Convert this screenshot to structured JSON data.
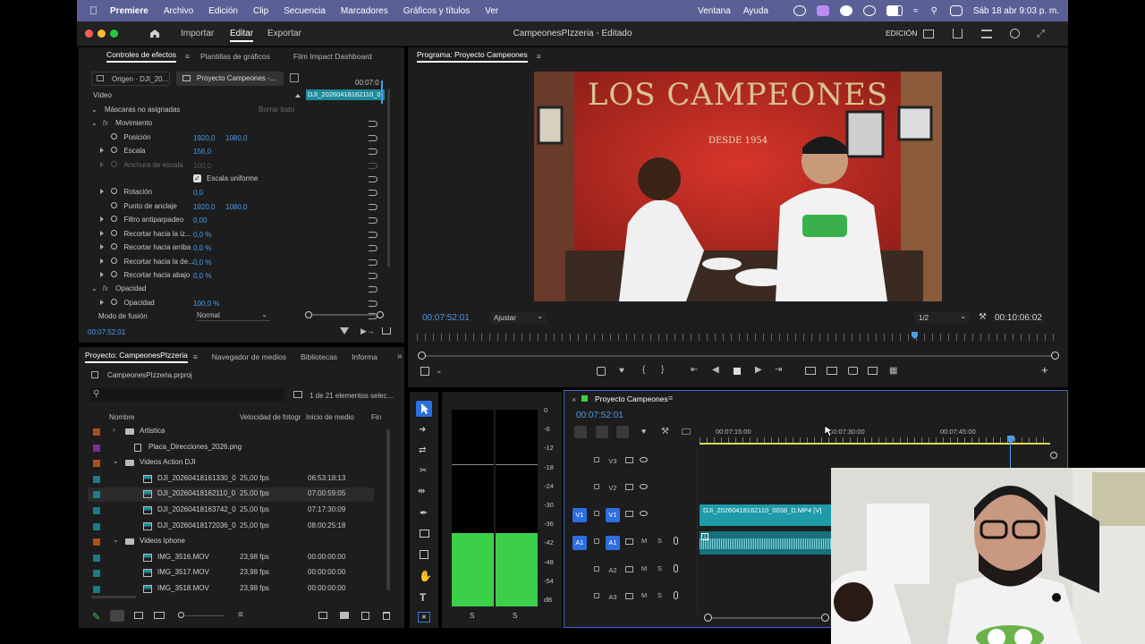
{
  "menubar": {
    "app": "Premiere",
    "items": [
      "Archivo",
      "Edición",
      "Clip",
      "Secuencia",
      "Marcadores",
      "Gráficos y títulos",
      "Ver"
    ],
    "right_items": [
      "Ventana",
      "Ayuda"
    ],
    "datetime": "Sáb 18 abr 9:03 p. m."
  },
  "titlebar": {
    "tabs": [
      "Importar",
      "Editar",
      "Exportar"
    ],
    "title": "CampeonesPIzzeria - Editado",
    "workspace": "EDICIÓN"
  },
  "effects_panel": {
    "tabs": [
      "Controles de efectos",
      "Plantillas de gráficos",
      "Film Impact Dashboard"
    ],
    "source_tab": "Origen · DJI_20...",
    "sequence_tab": "Proyecto Campeones -...",
    "mini_timecode": "00:07:0",
    "mini_clip": "DJI_20260418162110_0",
    "section": "Vídeo",
    "mask_label": "Máscaras no asignadas",
    "clear_all": "Borrar todo",
    "motion": "Movimiento",
    "position_label": "Posición",
    "position_x": "1920,0",
    "position_y": "1080,0",
    "scale_label": "Escala",
    "scale_value": "156,0",
    "scale_width_label": "Anchura de escala",
    "scale_width_value": "100,0",
    "uniform_scale_label": "Escala uniforme",
    "rotation_label": "Rotación",
    "rotation_value": "0,0",
    "anchor_label": "Punto de anclaje",
    "anchor_x": "1920,0",
    "anchor_y": "1080,0",
    "antiflicker_label": "Filtro antiparpadeo",
    "antiflicker_value": "0,00",
    "crop_left_label": "Recortar hacia la iz...",
    "crop_left_value": "0,0 %",
    "crop_top_label": "Recortar hacia arriba",
    "crop_top_value": "0,0 %",
    "crop_right_label": "Recortar hacia la de...",
    "crop_right_value": "0,0 %",
    "crop_bottom_label": "Recortar hacia abajo",
    "crop_bottom_value": "0,0 %",
    "opacity_section": "Opacidad",
    "opacity_label": "Opacidad",
    "opacity_value": "100,0 %",
    "blend_label": "Modo de fusión",
    "blend_value": "Normal",
    "timecode": "00:07:52:01"
  },
  "program_monitor": {
    "title": "Programa: Proyecto Campeones",
    "video_sign": "LOS CAMPEONES",
    "video_sign_sub": "DESDE 1954",
    "timecode": "00:07:52:01",
    "fit": "Ajustar",
    "resolution": "1/2",
    "duration": "00:10:06:02"
  },
  "project_panel": {
    "tabs": [
      "Proyecto: CampeonesPIzzeria",
      "Navegador de medios",
      "Bibliotecas",
      "Informa"
    ],
    "file": "CampeonesPIzzeria.prproj",
    "search_placeholder": "",
    "count": "1 de 21 elementos selec...",
    "columns": [
      "Nombre",
      "Velocidad de fotogr",
      "Inicio de medio",
      "Fin"
    ],
    "items": [
      {
        "name": "Artistica",
        "fps": "",
        "start": "",
        "color": "#c6561a",
        "kind": "folder",
        "indent": 0,
        "twirl": "closed"
      },
      {
        "name": "Placa_Direcciones_2026.png",
        "fps": "",
        "start": "",
        "color": "#8a2fb5",
        "kind": "image",
        "indent": 1,
        "twirl": ""
      },
      {
        "name": "Videos Action DJI",
        "fps": "",
        "start": "",
        "color": "#c6561a",
        "kind": "folder",
        "indent": 0,
        "twirl": "open"
      },
      {
        "name": "DJI_20260418161330_0",
        "fps": "25,00 fps",
        "start": "06:53:18:13",
        "color": "#1f8a9a",
        "kind": "clip",
        "indent": 2,
        "twirl": ""
      },
      {
        "name": "DJI_20260418162110_0",
        "fps": "25,00 fps",
        "start": "07:00:59:05",
        "color": "#1f8a9a",
        "kind": "clip",
        "indent": 2,
        "twirl": "",
        "selected": true
      },
      {
        "name": "DJI_20260418163742_0",
        "fps": "25,00 fps",
        "start": "07:17:30:09",
        "color": "#1f8a9a",
        "kind": "clip",
        "indent": 2,
        "twirl": ""
      },
      {
        "name": "DJI_20260418172036_0",
        "fps": "25,00 fps",
        "start": "08:00:25:18",
        "color": "#1f8a9a",
        "kind": "clip",
        "indent": 2,
        "twirl": ""
      },
      {
        "name": "Videos Iphone",
        "fps": "",
        "start": "",
        "color": "#c6561a",
        "kind": "folder",
        "indent": 0,
        "twirl": "open"
      },
      {
        "name": "IMG_3516.MOV",
        "fps": "23,98 fps",
        "start": "00:00:00:00",
        "color": "#1f8a9a",
        "kind": "clip",
        "indent": 2,
        "twirl": ""
      },
      {
        "name": "IMG_3517.MOV",
        "fps": "23,98 fps",
        "start": "00:00:00:00",
        "color": "#1f8a9a",
        "kind": "clip",
        "indent": 2,
        "twirl": ""
      },
      {
        "name": "IMG_3518.MOV",
        "fps": "23,98 fps",
        "start": "00:00:00:00",
        "color": "#1f8a9a",
        "kind": "clip",
        "indent": 2,
        "twirl": ""
      }
    ]
  },
  "audio_meter": {
    "scale": [
      "0",
      "-6",
      "-12",
      "-18",
      "-24",
      "-30",
      "-36",
      "-42",
      "-48",
      "-54",
      "dB"
    ],
    "channels": [
      "S",
      "S"
    ]
  },
  "timeline": {
    "title": "Proyecto Campeones",
    "timecode": "00:07:52:01",
    "ruler": [
      "00:07:15:00",
      "00:07:30:00",
      "00:07:45:00"
    ],
    "tracks": [
      {
        "name": "V3",
        "kind": "video"
      },
      {
        "name": "V2",
        "kind": "video"
      },
      {
        "name": "V1",
        "kind": "video",
        "source": "V1"
      },
      {
        "name": "A1",
        "kind": "audio",
        "source": "A1"
      },
      {
        "name": "A2",
        "kind": "audio"
      },
      {
        "name": "A3",
        "kind": "audio"
      }
    ],
    "clip_label": "DJI_20260418162110_0038_D.MP4 [V]",
    "mute": "M",
    "solo": "S",
    "audio_clip_label": "1"
  },
  "colors": {
    "accent": "#4b9ce8",
    "menubar": "#5a5f95",
    "clip_video": "#1e9aa8",
    "clip_audio": "#1a7f8a",
    "meter_green": "#3bcf4a"
  }
}
